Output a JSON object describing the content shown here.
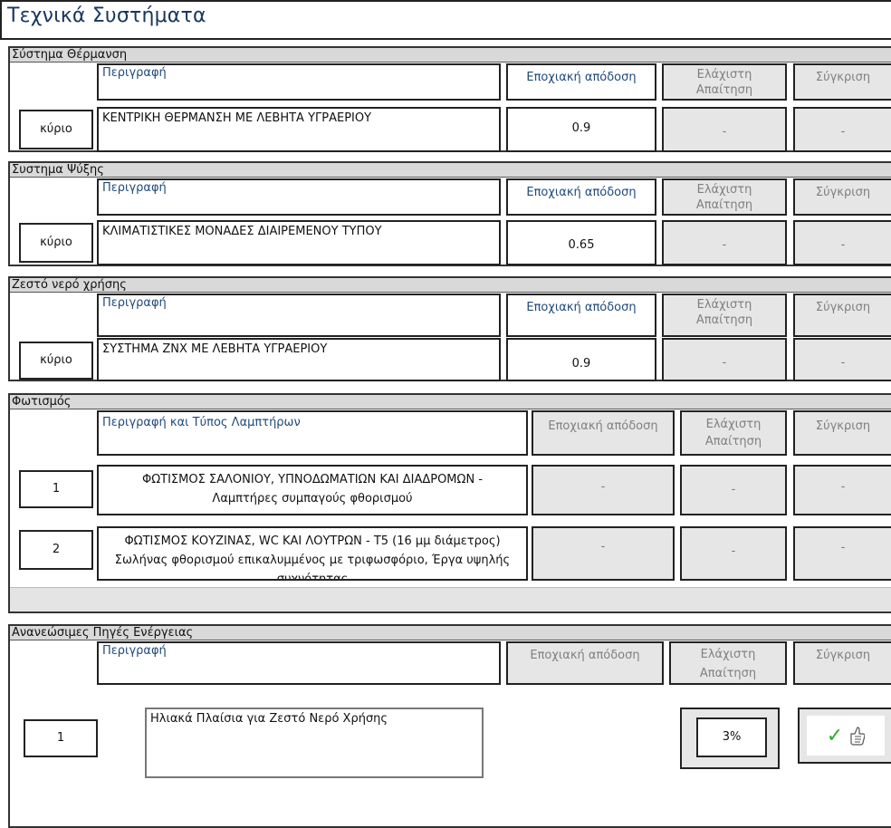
{
  "title": "Τεχνικά Συστήματα",
  "sections": {
    "heating": {
      "title": "Σύστημα Θέρμανση",
      "col_desc": "Περιγραφή",
      "col_eff": "Εποχιακή απόδοση",
      "col_min": "Ελάχιστη Απαίτηση",
      "col_cmp": "Σύγκριση",
      "row_label": "κύριο",
      "row_desc": "ΚΕΝΤΡΙΚΗ ΘΕΡΜΑΝΣΗ ΜΕ ΛΕΒΗΤΑ ΥΓΡΑΕΡΙΟΥ",
      "row_eff": "0.9",
      "row_min": "-",
      "row_cmp": "-"
    },
    "cooling": {
      "title": "Συστημα Ψύξης",
      "col_desc": "Περιγραφή",
      "col_eff": "Εποχιακή απόδοση",
      "col_min": "Ελάχιστη Απαίτηση",
      "col_cmp": "Σύγκριση",
      "row_label": "κύριο",
      "row_desc": "ΚΛΙΜΑΤΙΣΤΙΚΕΣ ΜΟΝΑΔΕΣ ΔΙΑΙΡΕΜΕΝΟΥ ΤΥΠΟΥ",
      "row_eff": "0.65",
      "row_min": "-",
      "row_cmp": "-"
    },
    "hotwater": {
      "title": "Ζεστό νερό χρήσης",
      "col_desc": "Περιγραφή",
      "col_eff": "Εποχιακή απόδοση",
      "col_min": "Ελάχιστη Απαίτηση",
      "col_cmp": "Σύγκριση",
      "row_label": "κύριο",
      "row_desc": "ΣΥΣΤΗΜΑ ΖΝΧ ΜΕ ΛΕΒΗΤΑ ΥΓΡΑΕΡΙΟΥ",
      "row_eff": "0.9",
      "row_min": "-",
      "row_cmp": "-"
    },
    "lighting": {
      "title": "Φωτισμός",
      "col_desc": "Περιγραφή και Τύπος Λαμπτήρων",
      "col_eff": "Εποχιακή απόδοση",
      "col_min": "Ελάχιστη Απαίτηση",
      "col_cmp": "Σύγκριση",
      "rows": [
        {
          "label": "1",
          "desc": "ΦΩΤΙΣΜΟΣ ΣΑΛΟΝΙΟΥ, ΥΠΝΟΔΩΜΑΤΙΩΝ ΚΑΙ ΔΙΑΔΡΟΜΩΝ - Λαμπτήρες συμπαγούς φθορισμού",
          "eff": "-",
          "min": "-",
          "cmp": "-"
        },
        {
          "label": "2",
          "desc": "ΦΩΤΙΣΜΟΣ ΚΟΥΖΙΝΑΣ, WC ΚΑΙ ΛΟΥΤΡΩΝ - T5 (16 μμ διάμετρος) Σωλήνας φθορισμού επικαλυμμένος με τριφωσφόριο, Έργα υψηλής συχνότητας",
          "eff": "-",
          "min": "-",
          "cmp": "-"
        }
      ]
    },
    "renewables": {
      "title": "Ανανεώσιμες Πηγές Ενέργειας",
      "col_desc": "Περιγραφή",
      "col_eff": "Εποχιακή απόδοση",
      "col_min": "Ελάχιστη Απαίτηση",
      "col_cmp": "Σύγκριση",
      "row_label": "1",
      "row_desc": "Ηλιακά Πλαίσια για Ζεστό Νερό Χρήσης",
      "row_min": "3%",
      "row_cmp_icons": [
        "check-icon",
        "thumbs-up-icon"
      ]
    }
  }
}
